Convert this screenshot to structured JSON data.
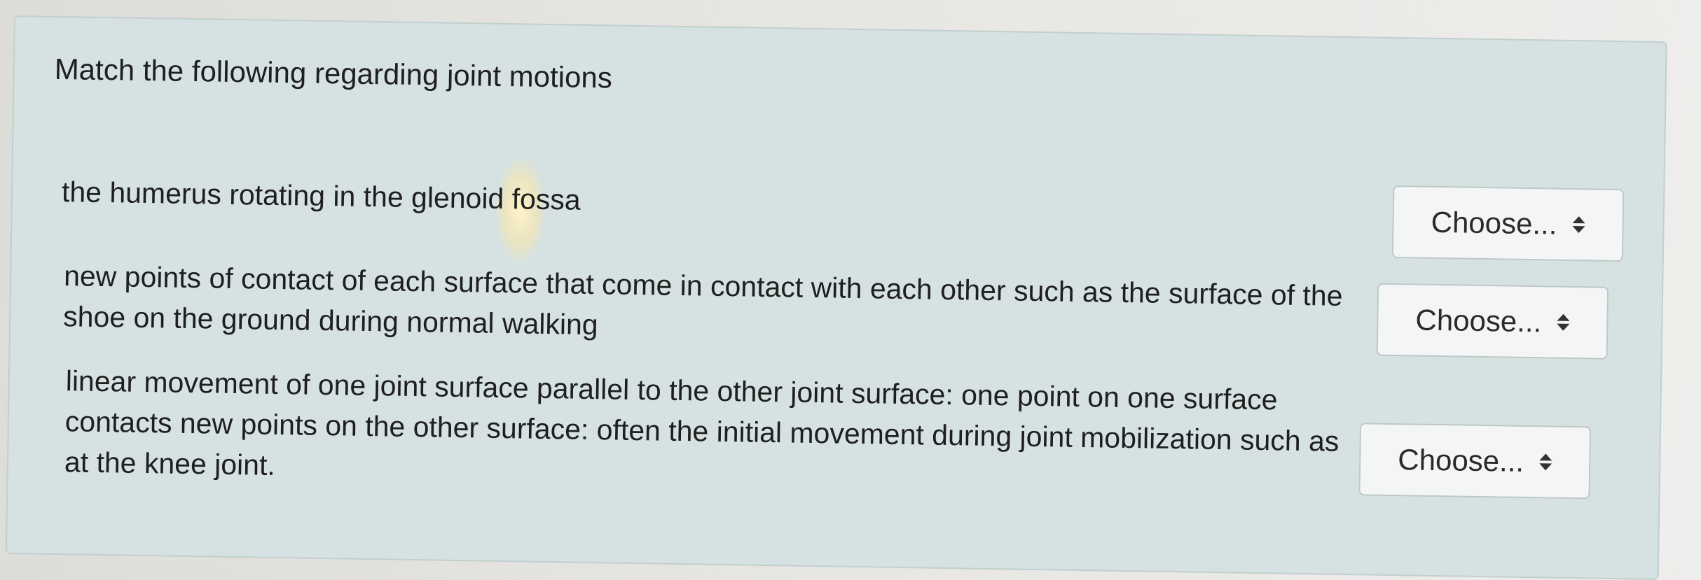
{
  "question": {
    "title": "Match the following regarding joint motions",
    "items": [
      {
        "prompt": "the humerus rotating in the glenoid fossa",
        "select": {
          "value": "Choose...",
          "icon": "sort-arrows-icon"
        }
      },
      {
        "prompt": "new points of contact of each surface that come in contact with each other such as the surface of the shoe on the ground during normal walking",
        "select": {
          "value": "Choose...",
          "icon": "sort-arrows-icon"
        }
      },
      {
        "prompt": "linear movement of one joint surface parallel to the other joint surface: one point on one surface contacts new points on the other surface: often the initial movement during joint mobilization such as at the knee joint.",
        "select": {
          "value": "Choose...",
          "icon": "sort-arrows-icon"
        }
      }
    ]
  },
  "colors": {
    "panel_background": "#d6e2e2",
    "select_background": "#f4f6f6",
    "text": "#1f1f1f"
  }
}
